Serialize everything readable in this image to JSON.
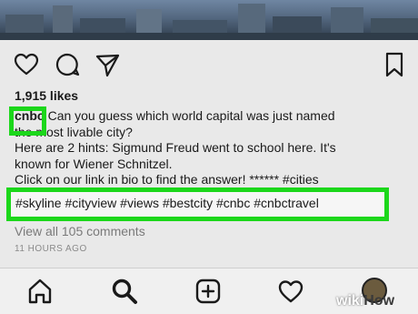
{
  "post": {
    "likes": "1,915 likes",
    "username": "cnbc",
    "caption_line1": "Can you guess which world capital was just named",
    "caption_line2": "the most livable city?",
    "caption_line3": "Here are 2 hints: Sigmund Freud went to school here. It's",
    "caption_line4": "known for Wiener Schnitzel.",
    "caption_line5": "Click on our link in bio to find the answer! ****** #cities",
    "hashtags": "#skyline #cityview #views #bestcity #cnbc #cnbctravel",
    "comments_link": "View all 105 comments",
    "timestamp": "11 HOURS AGO"
  },
  "icons": {
    "actions": [
      "heart-icon",
      "comment-icon",
      "share-icon",
      "bookmark-icon"
    ],
    "tabs": [
      "home-icon",
      "search-icon",
      "new-post-icon",
      "activity-icon",
      "profile-avatar"
    ]
  },
  "highlight_color": "#1cd71b",
  "watermark": {
    "part1": "wiki",
    "part2": "How"
  }
}
